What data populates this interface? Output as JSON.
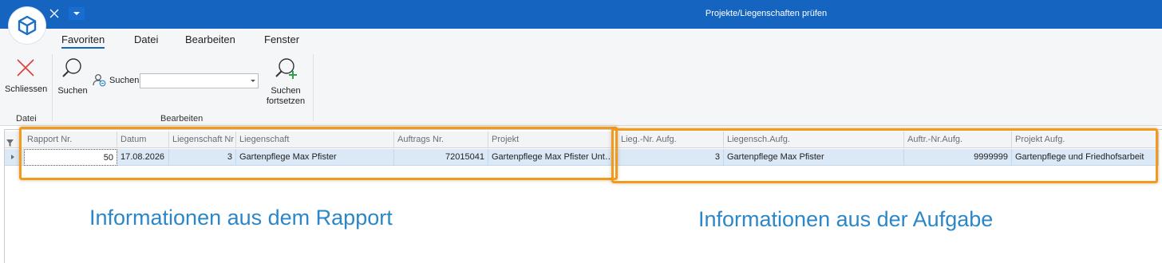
{
  "window": {
    "title": "Projekte/Liegenschaften prüfen",
    "accent_color": "#1565c0"
  },
  "icons": {
    "logo": "cube-logo-icon",
    "quick_close": "close-icon",
    "quick_menu": "chevron-down-icon"
  },
  "ribbon": {
    "tabs": [
      {
        "label": "Favoriten",
        "active": true
      },
      {
        "label": "Datei",
        "active": false
      },
      {
        "label": "Bearbeiten",
        "active": false
      },
      {
        "label": "Fenster",
        "active": false
      }
    ],
    "groups": {
      "datei": {
        "label": "Datei",
        "close_label": "Schliessen"
      },
      "bearbeiten": {
        "label": "Bearbeiten",
        "search_label": "Suchen",
        "search_combo_label": "Suchen",
        "search_combo_value": "",
        "continue_label_line1": "Suchen",
        "continue_label_line2": "fortsetzen"
      }
    }
  },
  "grid": {
    "columns": [
      "Rapport Nr.",
      "Datum",
      "Liegenschaft Nr",
      "Liegenschaft",
      "Auftrags Nr.",
      "Projekt",
      "Lieg.-Nr. Aufg.",
      "Liegensch.Aufg.",
      "Auftr.-Nr.Aufg.",
      "Projekt Aufg."
    ],
    "rows": [
      [
        "50",
        "17.08.2026",
        "3",
        "Gartenpflege Max Pfister",
        "72015041",
        "Gartenpflege Max Pfister Unterhalt",
        "3",
        "Gartenpflege Max Pfister",
        "9999999",
        "Gartenpflege und Friedhofsarbeit"
      ]
    ]
  },
  "annotations": {
    "rapport_label": "Informationen aus dem Rapport",
    "aufgabe_label": "Informationen aus der Aufgabe",
    "highlight_color": "#f39a1e",
    "text_color": "#2b87c8"
  }
}
